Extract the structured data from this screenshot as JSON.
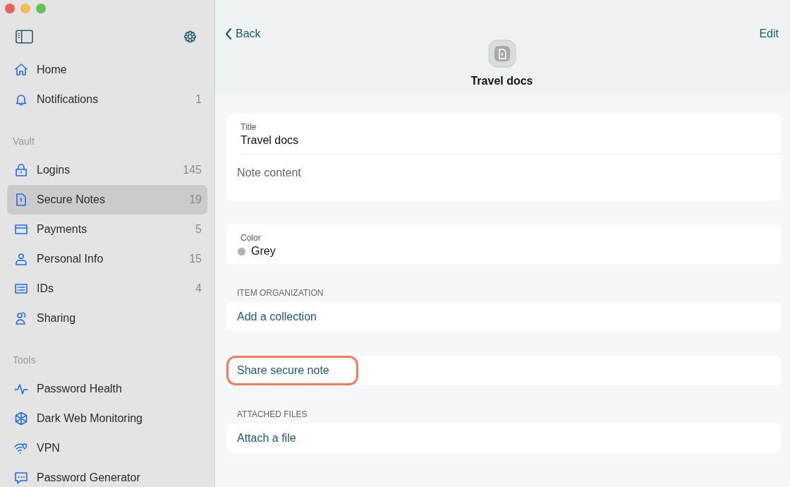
{
  "sidebar": {
    "top_items": [
      {
        "label": "Home",
        "selected": false
      },
      {
        "label": "Notifications",
        "count": "1",
        "selected": false
      }
    ],
    "groups": [
      {
        "heading": "Vault",
        "items": [
          {
            "label": "Logins",
            "count": "145",
            "selected": false
          },
          {
            "label": "Secure Notes",
            "count": "19",
            "selected": true
          },
          {
            "label": "Payments",
            "count": "5",
            "selected": false
          },
          {
            "label": "Personal Info",
            "count": "15",
            "selected": false
          },
          {
            "label": "IDs",
            "count": "4",
            "selected": false
          },
          {
            "label": "Sharing",
            "selected": false
          }
        ]
      },
      {
        "heading": "Tools",
        "items": [
          {
            "label": "Password Health",
            "selected": false
          },
          {
            "label": "Dark Web Monitoring",
            "selected": false
          },
          {
            "label": "VPN",
            "selected": false
          },
          {
            "label": "Password Generator",
            "selected": false
          }
        ]
      }
    ]
  },
  "header": {
    "back": "Back",
    "edit": "Edit",
    "title": "Travel docs"
  },
  "sections": [
    {
      "rows": [
        {
          "kind": "field",
          "label": "Title",
          "value": "Travel docs"
        },
        {
          "kind": "placeholder",
          "placeholder": "Note content"
        }
      ]
    },
    {
      "rows": [
        {
          "kind": "color",
          "label": "Color",
          "value": "Grey",
          "color": "#b0b0b0"
        }
      ]
    },
    {
      "heading": "ITEM ORGANIZATION",
      "rows": [
        {
          "kind": "action",
          "label": "Add a collection",
          "highlighted": false
        }
      ]
    },
    {
      "rows": [
        {
          "kind": "action",
          "label": "Share secure note",
          "highlighted": true
        }
      ]
    },
    {
      "heading": "ATTACHED FILES",
      "rows": [
        {
          "kind": "action",
          "label": "Attach a file",
          "highlighted": false
        }
      ]
    }
  ]
}
